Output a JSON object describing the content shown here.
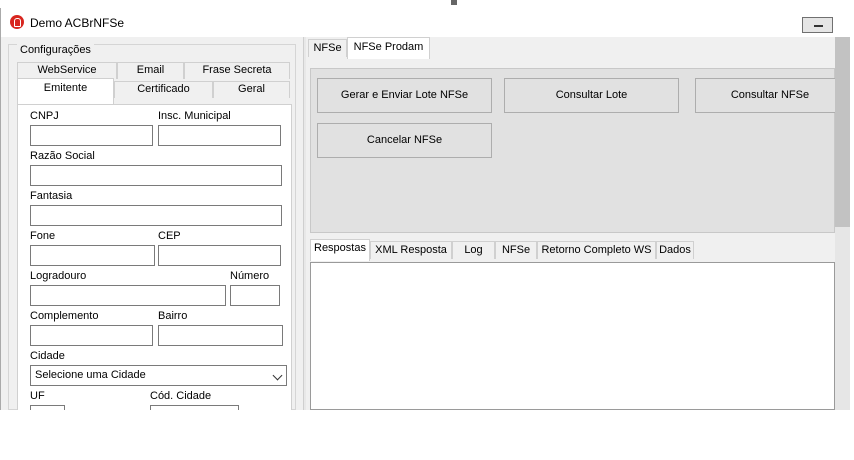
{
  "window": {
    "title": "Demo ACBrNFSe"
  },
  "left": {
    "group_caption": "Configurações",
    "tabs_row1": [
      "WebService",
      "Email",
      "Frase Secreta"
    ],
    "tabs_row2": [
      "Emitente",
      "Certificado",
      "Geral"
    ],
    "fields": {
      "cnpj": "CNPJ",
      "insc_municipal": "Insc. Municipal",
      "razao_social": "Razão Social",
      "fantasia": "Fantasia",
      "fone": "Fone",
      "cep": "CEP",
      "logradouro": "Logradouro",
      "numero": "Número",
      "complemento": "Complemento",
      "bairro": "Bairro",
      "cidade": "Cidade",
      "cidade_value": "Selecione uma Cidade",
      "uf": "UF",
      "cod_cidade": "Cód. Cidade"
    }
  },
  "right": {
    "top_tabs": [
      "NFSe",
      "NFSe Prodam"
    ],
    "buttons": {
      "gerar": "Gerar e Enviar Lote NFSe",
      "consultar_lote": "Consultar Lote",
      "consultar_nfse": "Consultar NFSe",
      "cancelar": "Cancelar NFSe"
    },
    "response_tabs": [
      "Respostas",
      "XML Resposta",
      "Log",
      "NFSe",
      "Retorno Completo WS",
      "Dados"
    ]
  }
}
